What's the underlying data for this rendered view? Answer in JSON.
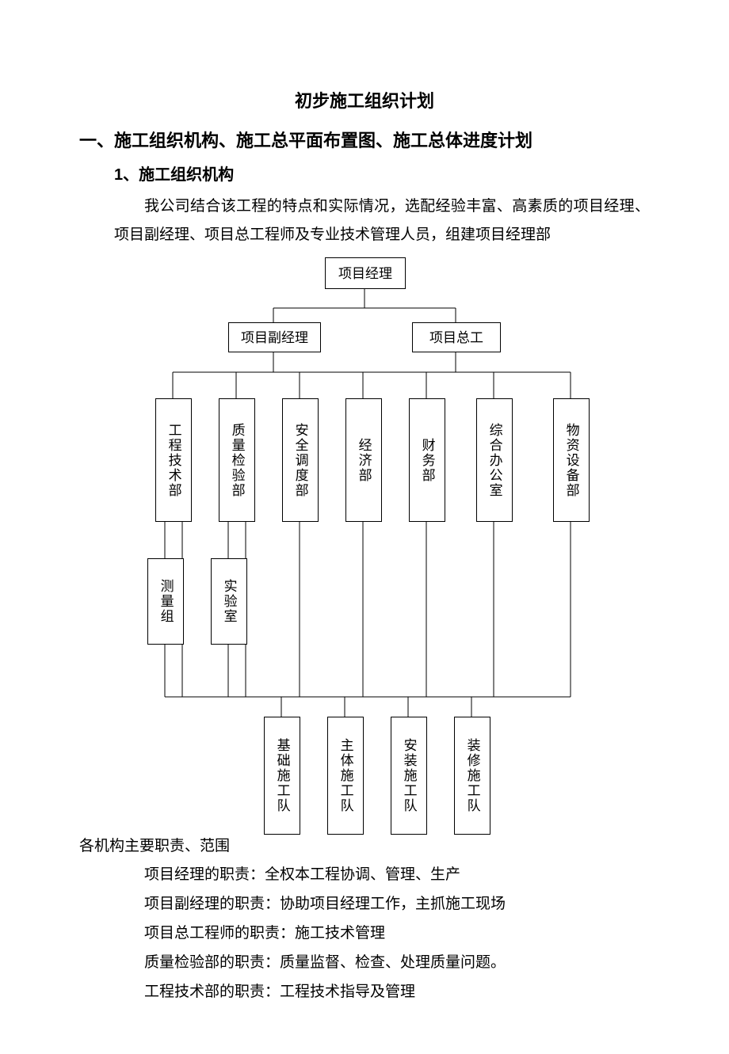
{
  "title": "初步施工组织计划",
  "section1_heading": "一、施工组织机构、施工总平面布置图、施工总体进度计划",
  "section1_sub1": "1、施工组织机构",
  "para1": "我公司结合该工程的特点和实际情况，选配经验丰富、高素质的项目经理、项目副经理、项目总工程师及专业技术管理人员，组建项目经理部",
  "chart_data": {
    "type": "org",
    "root": "项目经理",
    "level2": [
      "项目副经理",
      "项目总工"
    ],
    "level3": [
      "工程技术部",
      "质量检验部",
      "安全调度部",
      "经济部",
      "财务部",
      "综合办公室",
      "物资设备部"
    ],
    "level3_sub": {
      "0": "测量组",
      "1": "实验室"
    },
    "level4": [
      "基础施工队",
      "主体施工队",
      "安装施工队",
      "装修施工队"
    ]
  },
  "duties_heading": "各机构主要职责、范围",
  "duties": [
    "项目经理的职责：全权本工程协调、管理、生产",
    "项目副经理的职责：协助项目经理工作，主抓施工现场",
    "项目总工程师的职责：施工技术管理",
    "质量检验部的职责：质量监督、检查、处理质量问题。",
    "工程技术部的职责：工程技术指导及管理"
  ]
}
